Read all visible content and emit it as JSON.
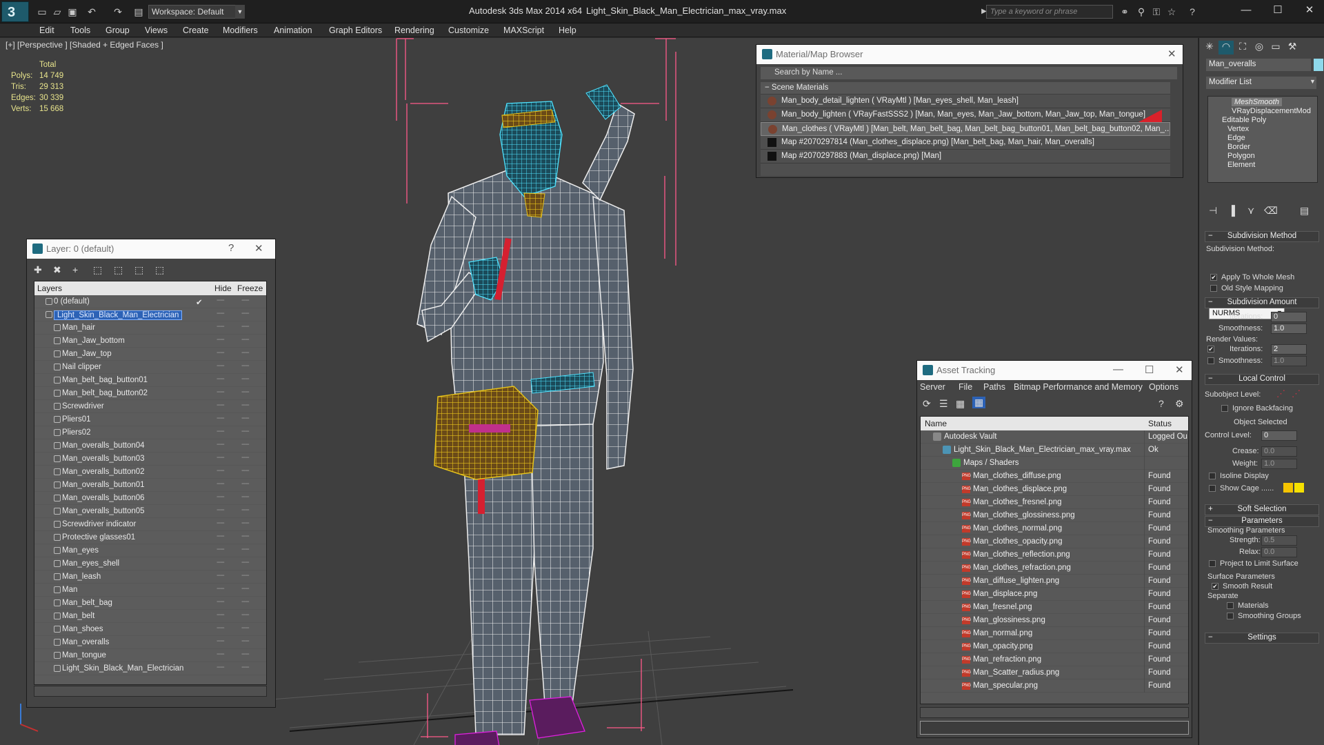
{
  "window": {
    "app_title": "Autodesk 3ds Max  2014 x64",
    "document": "Light_Skin_Black_Man_Electrician_max_vray.max",
    "workspace": "Workspace: Default",
    "search_placeholder": "Type a keyword or phrase"
  },
  "menu": [
    "Edit",
    "Tools",
    "Group",
    "Views",
    "Create",
    "Modifiers",
    "Animation",
    "Graph Editors",
    "Rendering",
    "Customize",
    "MAXScript",
    "Help"
  ],
  "viewport": {
    "label": "[+] [Perspective ] [Shaded + Edged Faces ]",
    "stats_header": "Total",
    "stats": [
      {
        "label": "Polys:",
        "value": "14 749"
      },
      {
        "label": "Tris:",
        "value": "29 313"
      },
      {
        "label": "Edges:",
        "value": "30 339"
      },
      {
        "label": "Verts:",
        "value": "15 668"
      }
    ]
  },
  "layer_panel": {
    "title": "Layer: 0 (default)",
    "help": "?",
    "columns": {
      "layers": "Layers",
      "hide": "Hide",
      "freeze": "Freeze"
    },
    "rows": [
      {
        "name": "0 (default)",
        "level": 1,
        "check": "✔"
      },
      {
        "name": "Light_Skin_Black_Man_Electrician",
        "level": 1,
        "selected": true
      },
      {
        "name": "Man_hair",
        "level": 2
      },
      {
        "name": "Man_Jaw_bottom",
        "level": 2
      },
      {
        "name": "Man_Jaw_top",
        "level": 2
      },
      {
        "name": "Nail clipper",
        "level": 2
      },
      {
        "name": "Man_belt_bag_button01",
        "level": 2
      },
      {
        "name": "Man_belt_bag_button02",
        "level": 2
      },
      {
        "name": "Screwdriver",
        "level": 2
      },
      {
        "name": "Pliers01",
        "level": 2
      },
      {
        "name": "Pliers02",
        "level": 2
      },
      {
        "name": "Man_overalls_button04",
        "level": 2
      },
      {
        "name": "Man_overalls_button03",
        "level": 2
      },
      {
        "name": "Man_overalls_button02",
        "level": 2
      },
      {
        "name": "Man_overalls_button01",
        "level": 2
      },
      {
        "name": "Man_overalls_button06",
        "level": 2
      },
      {
        "name": "Man_overalls_button05",
        "level": 2
      },
      {
        "name": "Screwdriver indicator",
        "level": 2
      },
      {
        "name": "Protective glasses01",
        "level": 2
      },
      {
        "name": "Man_eyes",
        "level": 2
      },
      {
        "name": "Man_eyes_shell",
        "level": 2
      },
      {
        "name": "Man_leash",
        "level": 2
      },
      {
        "name": "Man",
        "level": 2
      },
      {
        "name": "Man_belt_bag",
        "level": 2
      },
      {
        "name": "Man_belt",
        "level": 2
      },
      {
        "name": "Man_shoes",
        "level": 2
      },
      {
        "name": "Man_overalls",
        "level": 2
      },
      {
        "name": "Man_tongue",
        "level": 2
      },
      {
        "name": "Light_Skin_Black_Man_Electrician",
        "level": 2
      }
    ]
  },
  "material_browser": {
    "title": "Material/Map Browser",
    "search": "Search by Name ...",
    "section": "Scene Materials",
    "rows": [
      {
        "text": "Man_body_detail_lighten  ( VRayMtl ) [Man_eyes_shell, Man_leash]",
        "type": "mat"
      },
      {
        "text": "Man_body_lighten  ( VRayFastSSS2 ) [Man, Man_eyes, Man_Jaw_bottom, Man_Jaw_top, Man_tongue]",
        "type": "mat"
      },
      {
        "text": "Man_clothes  ( VRayMtl ) [Man_belt, Man_belt_bag, Man_belt_bag_button01, Man_belt_bag_button02, Man_...",
        "type": "mat",
        "highlight": true
      },
      {
        "text": "Map #2070297814 (Man_clothes_displace.png)  [Man_belt_bag, Man_hair, Man_overalls]",
        "type": "map"
      },
      {
        "text": "Map #2070297883 (Man_displace.png)  [Man]",
        "type": "map"
      }
    ]
  },
  "asset_tracking": {
    "title": "Asset Tracking",
    "menu": [
      "Server",
      "File",
      "Paths",
      "Bitmap Performance and Memory",
      "Options"
    ],
    "columns": {
      "name": "Name",
      "status": "Status"
    },
    "rows": [
      {
        "name": "Autodesk Vault",
        "status": "Logged Ou",
        "level": 0,
        "kind": "vault"
      },
      {
        "name": "Light_Skin_Black_Man_Electrician_max_vray.max",
        "status": "Ok",
        "level": 1,
        "kind": "max"
      },
      {
        "name": "Maps / Shaders",
        "status": "",
        "level": 2,
        "kind": "folder"
      },
      {
        "name": "Man_clothes_diffuse.png",
        "status": "Found",
        "level": 3,
        "kind": "png"
      },
      {
        "name": "Man_clothes_displace.png",
        "status": "Found",
        "level": 3,
        "kind": "png"
      },
      {
        "name": "Man_clothes_fresnel.png",
        "status": "Found",
        "level": 3,
        "kind": "png"
      },
      {
        "name": "Man_clothes_glossiness.png",
        "status": "Found",
        "level": 3,
        "kind": "png"
      },
      {
        "name": "Man_clothes_normal.png",
        "status": "Found",
        "level": 3,
        "kind": "png"
      },
      {
        "name": "Man_clothes_opacity.png",
        "status": "Found",
        "level": 3,
        "kind": "png"
      },
      {
        "name": "Man_clothes_reflection.png",
        "status": "Found",
        "level": 3,
        "kind": "png"
      },
      {
        "name": "Man_clothes_refraction.png",
        "status": "Found",
        "level": 3,
        "kind": "png"
      },
      {
        "name": "Man_diffuse_lighten.png",
        "status": "Found",
        "level": 3,
        "kind": "png"
      },
      {
        "name": "Man_displace.png",
        "status": "Found",
        "level": 3,
        "kind": "png"
      },
      {
        "name": "Man_fresnel.png",
        "status": "Found",
        "level": 3,
        "kind": "png"
      },
      {
        "name": "Man_glossiness.png",
        "status": "Found",
        "level": 3,
        "kind": "png"
      },
      {
        "name": "Man_normal.png",
        "status": "Found",
        "level": 3,
        "kind": "png"
      },
      {
        "name": "Man_opacity.png",
        "status": "Found",
        "level": 3,
        "kind": "png"
      },
      {
        "name": "Man_refraction.png",
        "status": "Found",
        "level": 3,
        "kind": "png"
      },
      {
        "name": "Man_Scatter_radius.png",
        "status": "Found",
        "level": 3,
        "kind": "png"
      },
      {
        "name": "Man_specular.png",
        "status": "Found",
        "level": 3,
        "kind": "png"
      }
    ]
  },
  "command_panel": {
    "object_name": "Man_overalls",
    "object_color": "#8ed8ea",
    "modifier_list": "Modifier List",
    "stack": [
      {
        "name": "MeshSmooth",
        "italic": true
      },
      {
        "name": "VRayDisplacementMod"
      },
      {
        "name": "Editable Poly"
      },
      {
        "name": "Vertex",
        "sub": true
      },
      {
        "name": "Edge",
        "sub": true
      },
      {
        "name": "Border",
        "sub": true
      },
      {
        "name": "Polygon",
        "sub": true
      },
      {
        "name": "Element",
        "sub": true
      }
    ],
    "subdivision_method": {
      "title": "Subdivision Method",
      "label": "Subdivision Method:",
      "value": "NURMS",
      "apply_whole": "Apply To Whole Mesh",
      "old_style": "Old Style Mapping"
    },
    "subdivision_amount": {
      "title": "Subdivision Amount",
      "iterations_label": "Iterations:",
      "iterations": "0",
      "smoothness_label": "Smoothness:",
      "smoothness": "1.0",
      "render_values": "Render Values:",
      "r_iterations_label": "Iterations:",
      "r_iterations": "2",
      "r_smoothness_label": "Smoothness:",
      "r_smoothness": "1.0"
    },
    "local_control": {
      "title": "Local Control",
      "subobject": "Subobject Level:",
      "ignore_backfacing": "Ignore Backfacing",
      "object_selected": "Object Selected",
      "control_level_label": "Control Level:",
      "control_level": "0",
      "crease_label": "Crease:",
      "crease": "0.0",
      "weight_label": "Weight:",
      "weight": "1.0",
      "isoline": "Isoline Display",
      "show_cage": "Show Cage ......"
    },
    "soft_selection": "Soft Selection",
    "parameters": {
      "title": "Parameters",
      "smoothing_params": "Smoothing Parameters",
      "strength_label": "Strength:",
      "strength": "0.5",
      "relax_label": "Relax:",
      "relax": "0.0",
      "project_limit": "Project to Limit Surface",
      "surface_params": "Surface Parameters",
      "smooth_result": "Smooth Result",
      "separate": "Separate",
      "materials": "Materials",
      "smoothing_groups": "Smoothing Groups"
    },
    "settings": "Settings"
  },
  "colors": {
    "wire_white": "#ffffff",
    "wire_cyan": "#4fe3ff",
    "wire_yellow": "#e6c21a",
    "wire_magenta": "#e020e0",
    "bbox_pink": "#ff5a8a",
    "selection_blue": "#2c62b6",
    "cage_yellow": "#f5c400"
  }
}
